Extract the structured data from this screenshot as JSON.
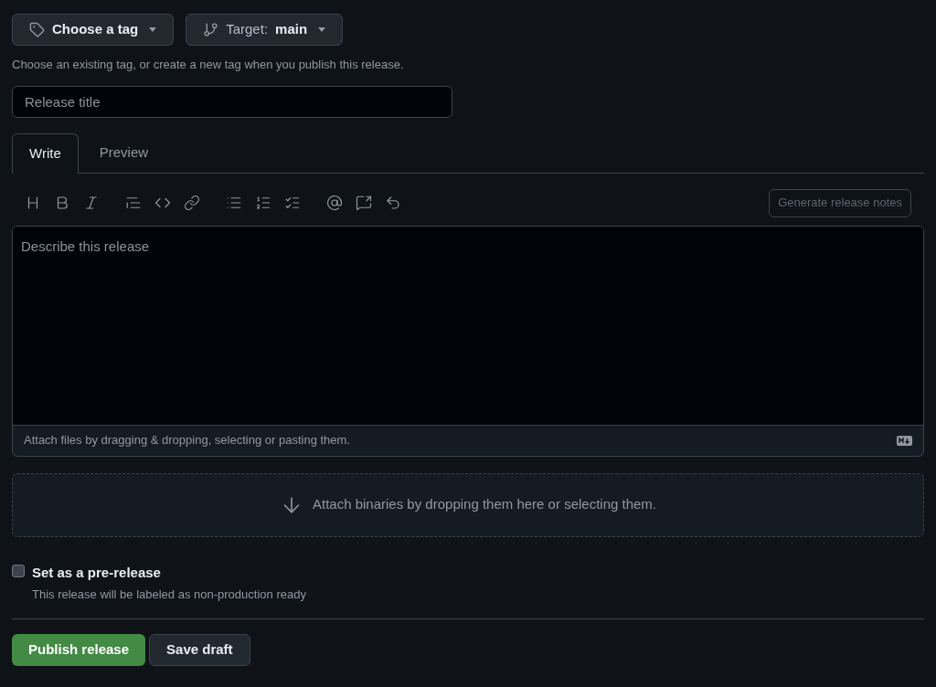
{
  "tag_picker": {
    "label": "Choose a tag"
  },
  "target_picker": {
    "prefix": "Target:",
    "branch": "main"
  },
  "tag_hint": "Choose an existing tag, or create a new tag when you publish this release.",
  "title_field": {
    "placeholder": "Release title"
  },
  "tabs": [
    {
      "label": "Write",
      "selected": true
    },
    {
      "label": "Preview",
      "selected": false
    }
  ],
  "generate_notes": {
    "label": "Generate release notes",
    "disabled": true
  },
  "body_field": {
    "placeholder": "Describe this release"
  },
  "attach_hint": "Attach files by dragging & dropping, selecting or pasting them.",
  "binaries_drop": "Attach binaries by dropping them here or selecting them.",
  "prerelease": {
    "label": "Set as a pre-release",
    "description": "This release will be labeled as non-production ready",
    "checked": false
  },
  "buttons": [
    {
      "kind": "primary",
      "label": "Publish release"
    },
    {
      "kind": "secondary",
      "label": "Save draft"
    }
  ]
}
